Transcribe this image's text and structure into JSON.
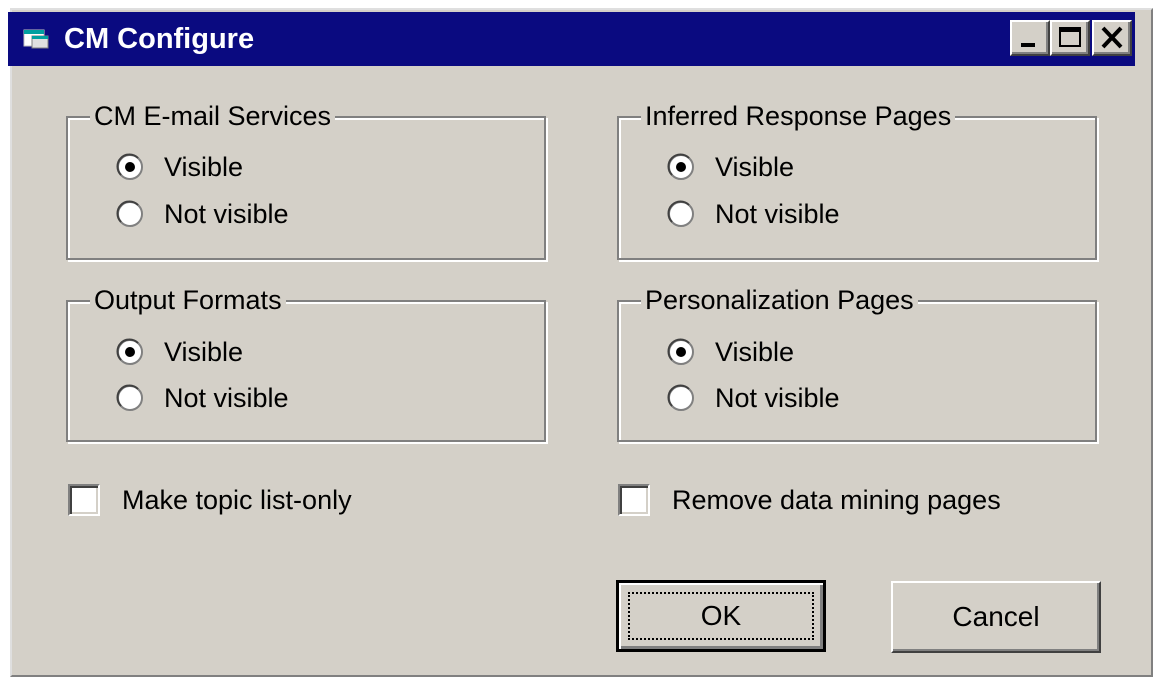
{
  "window": {
    "title": "CM Configure",
    "icon": "app-window-icon",
    "controls": [
      "minimize-icon",
      "maximize-icon",
      "close-icon"
    ]
  },
  "groups": {
    "email_services": {
      "label": "CM E-mail Services",
      "options": [
        "Visible",
        "Not visible"
      ],
      "selected": "Visible"
    },
    "inferred_response": {
      "label": "Inferred Response Pages",
      "options": [
        "Visible",
        "Not visible"
      ],
      "selected": "Visible"
    },
    "output_formats": {
      "label": "Output Formats",
      "options": [
        "Visible",
        "Not visible"
      ],
      "selected": "Visible"
    },
    "personalization": {
      "label": "Personalization Pages",
      "options": [
        "Visible",
        "Not visible"
      ],
      "selected": "Visible"
    }
  },
  "checkboxes": {
    "topic_list_only": {
      "label": "Make topic list-only",
      "checked": false
    },
    "remove_data_mining": {
      "label": "Remove data mining pages",
      "checked": false
    }
  },
  "buttons": {
    "ok": "OK",
    "cancel": "Cancel"
  },
  "colors": {
    "titlebar": "#0a0a80",
    "face": "#d4d0c8"
  }
}
